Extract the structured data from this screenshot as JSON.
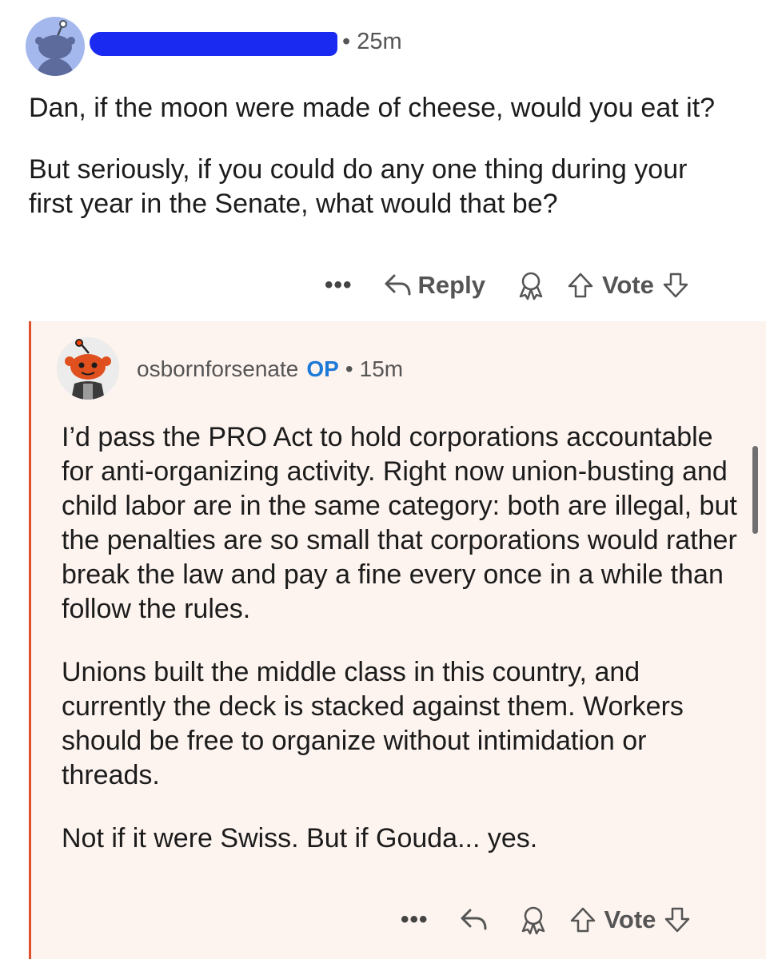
{
  "parent_comment": {
    "timestamp": "• 25m",
    "paragraphs": [
      "Dan, if the moon were made of cheese, would you eat it?",
      "But seriously, if you could do any one thing during your first year in the Senate, what would that be?"
    ],
    "actions": {
      "more": "•••",
      "reply_label": "Reply",
      "vote_label": "Vote"
    }
  },
  "reply_comment": {
    "username": "osbornforsenate",
    "op_tag": "OP",
    "separator": "•",
    "timestamp": "15m",
    "paragraphs": [
      "I’d pass the PRO Act to hold corporations accountable for anti-organizing activity. Right now union-busting and child labor are in the same category: both are illegal, but the penalties are so small that corporations would rather break the law and pay a fine every once in a while than follow the rules.",
      "Unions built the middle class in this country, and currently the deck is stacked against them. Workers should be free to organize without intimidation or threads.",
      "Not if it were Swiss. But if Gouda... yes."
    ],
    "actions": {
      "more": "•••",
      "vote_label": "Vote"
    }
  },
  "colors": {
    "accent_orange": "#e04f2c",
    "op_blue": "#1d7ad6",
    "reply_background": "#fdf3ef",
    "redaction_blue": "#1a2af0"
  },
  "icons": [
    "snoo-avatar-icon",
    "reply-arrow-icon",
    "award-icon",
    "upvote-icon",
    "downvote-icon",
    "more-dots-icon"
  ]
}
